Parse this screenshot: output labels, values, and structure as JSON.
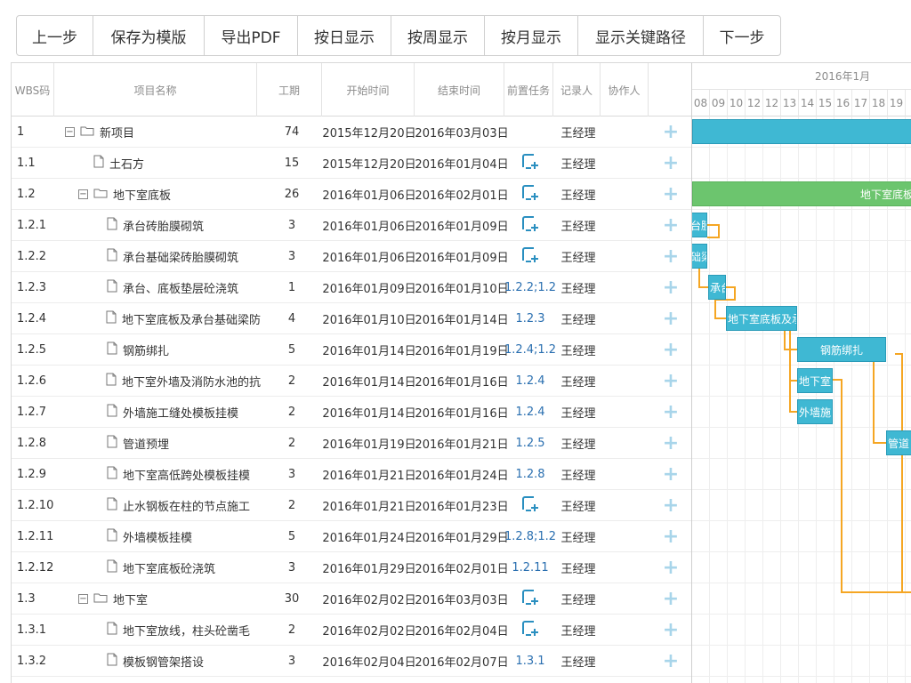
{
  "toolbar": {
    "buttons": [
      "上一步",
      "保存为模版",
      "导出PDF",
      "按日显示",
      "按周显示",
      "按月显示",
      "显示关键路径",
      "下一步"
    ]
  },
  "table": {
    "headers": [
      "WBS码",
      "项目名称",
      "工期",
      "开始时间",
      "结束时间",
      "前置任务",
      "记录人",
      "协作人"
    ],
    "rows": [
      {
        "wbs": "1",
        "name": "新项目",
        "dur": "74",
        "start": "2015年12月20日",
        "end": "2016年03月03日",
        "pred": "",
        "rec": "王经理",
        "type": "folder",
        "level": 0
      },
      {
        "wbs": "1.1",
        "name": "土石方",
        "dur": "15",
        "start": "2015年12月20日",
        "end": "2016年01月04日",
        "pred": "",
        "rec": "王经理",
        "type": "file",
        "level": 1,
        "linkicon": true
      },
      {
        "wbs": "1.2",
        "name": "地下室底板",
        "dur": "26",
        "start": "2016年01月06日",
        "end": "2016年02月01日",
        "pred": "",
        "rec": "王经理",
        "type": "folder",
        "level": 1,
        "linkicon": true
      },
      {
        "wbs": "1.2.1",
        "name": "承台砖胎膜砌筑",
        "dur": "3",
        "start": "2016年01月06日",
        "end": "2016年01月09日",
        "pred": "",
        "rec": "王经理",
        "type": "file",
        "level": 2,
        "linkicon": true
      },
      {
        "wbs": "1.2.2",
        "name": "承台基础梁砖胎膜砌筑",
        "dur": "3",
        "start": "2016年01月06日",
        "end": "2016年01月09日",
        "pred": "",
        "rec": "王经理",
        "type": "file",
        "level": 2,
        "linkicon": true
      },
      {
        "wbs": "1.2.3",
        "name": "承台、底板垫层砼浇筑",
        "dur": "1",
        "start": "2016年01月09日",
        "end": "2016年01月10日",
        "pred": "1.2.2;1.2",
        "rec": "王经理",
        "type": "file",
        "level": 2
      },
      {
        "wbs": "1.2.4",
        "name": "地下室底板及承台基础梁防",
        "dur": "4",
        "start": "2016年01月10日",
        "end": "2016年01月14日",
        "pred": "1.2.3",
        "rec": "王经理",
        "type": "file",
        "level": 2
      },
      {
        "wbs": "1.2.5",
        "name": "钢筋绑扎",
        "dur": "5",
        "start": "2016年01月14日",
        "end": "2016年01月19日",
        "pred": "1.2.4;1.2",
        "rec": "王经理",
        "type": "file",
        "level": 2
      },
      {
        "wbs": "1.2.6",
        "name": "地下室外墙及消防水池的抗",
        "dur": "2",
        "start": "2016年01月14日",
        "end": "2016年01月16日",
        "pred": "1.2.4",
        "rec": "王经理",
        "type": "file",
        "level": 2
      },
      {
        "wbs": "1.2.7",
        "name": "外墙施工缝处模板挂模",
        "dur": "2",
        "start": "2016年01月14日",
        "end": "2016年01月16日",
        "pred": "1.2.4",
        "rec": "王经理",
        "type": "file",
        "level": 2
      },
      {
        "wbs": "1.2.8",
        "name": "管道预埋",
        "dur": "2",
        "start": "2016年01月19日",
        "end": "2016年01月21日",
        "pred": "1.2.5",
        "rec": "王经理",
        "type": "file",
        "level": 2
      },
      {
        "wbs": "1.2.9",
        "name": "地下室高低跨处模板挂模",
        "dur": "3",
        "start": "2016年01月21日",
        "end": "2016年01月24日",
        "pred": "1.2.8",
        "rec": "王经理",
        "type": "file",
        "level": 2
      },
      {
        "wbs": "1.2.10",
        "name": "止水钢板在柱的节点施工",
        "dur": "2",
        "start": "2016年01月21日",
        "end": "2016年01月23日",
        "pred": "",
        "rec": "王经理",
        "type": "file",
        "level": 2,
        "linkicon": true
      },
      {
        "wbs": "1.2.11",
        "name": "外墙模板挂模",
        "dur": "5",
        "start": "2016年01月24日",
        "end": "2016年01月29日",
        "pred": "1.2.8;1.2",
        "rec": "王经理",
        "type": "file",
        "level": 2
      },
      {
        "wbs": "1.2.12",
        "name": "地下室底板砼浇筑",
        "dur": "3",
        "start": "2016年01月29日",
        "end": "2016年02月01日",
        "pred": "1.2.11",
        "rec": "王经理",
        "type": "file",
        "level": 2
      },
      {
        "wbs": "1.3",
        "name": "地下室",
        "dur": "30",
        "start": "2016年02月02日",
        "end": "2016年03月03日",
        "pred": "",
        "rec": "王经理",
        "type": "folder",
        "level": 1,
        "linkicon": true
      },
      {
        "wbs": "1.3.1",
        "name": "地下室放线，柱头砼凿毛",
        "dur": "2",
        "start": "2016年02月02日",
        "end": "2016年02月04日",
        "pred": "",
        "rec": "王经理",
        "type": "file",
        "level": 2,
        "linkicon": true
      },
      {
        "wbs": "1.3.2",
        "name": "模板钢管架搭设",
        "dur": "3",
        "start": "2016年02月04日",
        "end": "2016年02月07日",
        "pred": "1.3.1",
        "rec": "王经理",
        "type": "file",
        "level": 2
      }
    ]
  },
  "gantt": {
    "month": "2016年1月",
    "days": [
      "08",
      "09",
      "10",
      "12",
      "12",
      "13",
      "14",
      "15",
      "16",
      "17",
      "18",
      "19",
      "2"
    ],
    "bars": [
      {
        "row": 0,
        "label": "",
        "color": "#3fb8d3"
      },
      {
        "row": 2,
        "label": "地下室底板",
        "color": "#6cc56e"
      },
      {
        "row": 3,
        "label": "台膜",
        "color": "#3fb8d3"
      },
      {
        "row": 4,
        "label": "础梁",
        "color": "#3fb8d3"
      },
      {
        "row": 5,
        "label": "承台",
        "color": "#3fb8d3"
      },
      {
        "row": 6,
        "label": "地下室底板及承",
        "color": "#3fb8d3"
      },
      {
        "row": 7,
        "label": "钢筋绑扎",
        "color": "#3fb8d3"
      },
      {
        "row": 8,
        "label": "地下室",
        "color": "#3fb8d3"
      },
      {
        "row": 9,
        "label": "外墙施",
        "color": "#3fb8d3"
      },
      {
        "row": 10,
        "label": "管道",
        "color": "#3fb8d3"
      }
    ],
    "link_color": "#f5a623"
  }
}
